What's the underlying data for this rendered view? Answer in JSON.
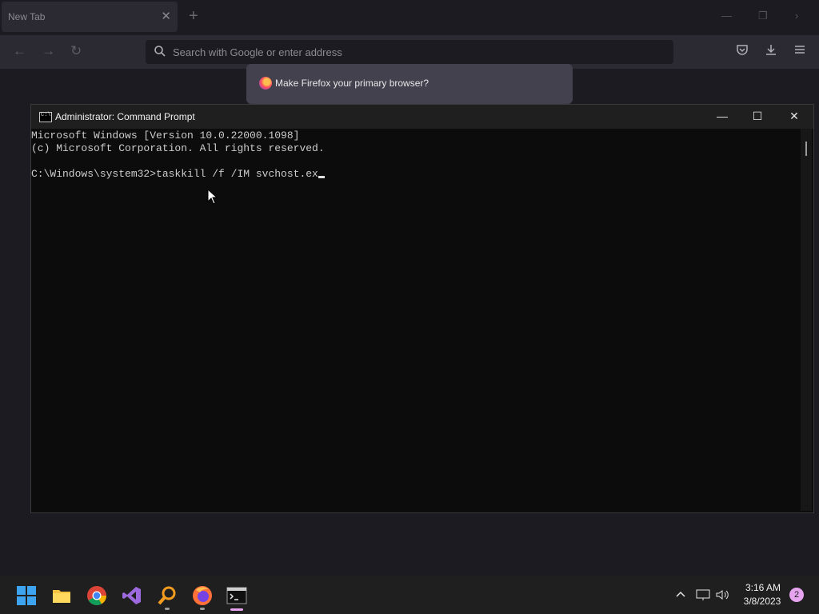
{
  "browser": {
    "tab_title": "New Tab",
    "address_placeholder": "Search with Google or enter address",
    "notification": "Make Firefox your primary browser?",
    "icons": {
      "back": "back-arrow-icon",
      "forward": "forward-arrow-icon",
      "reload": "reload-icon",
      "pocket": "pocket-icon",
      "downloads": "download-icon",
      "menu": "hamburger-menu-icon"
    }
  },
  "cmd": {
    "title": "Administrator: Command Prompt",
    "lines": [
      "Microsoft Windows [Version 10.0.22000.1098]",
      "(c) Microsoft Corporation. All rights reserved.",
      "",
      "C:\\Windows\\system32>taskkill /f /IM svchost.ex"
    ]
  },
  "taskbar": {
    "apps": [
      "start",
      "file-explorer",
      "chrome",
      "visual-studio",
      "search-tool",
      "firefox",
      "command-prompt"
    ],
    "time": "3:16 AM",
    "date": "3/8/2023",
    "notification_count": "2"
  }
}
